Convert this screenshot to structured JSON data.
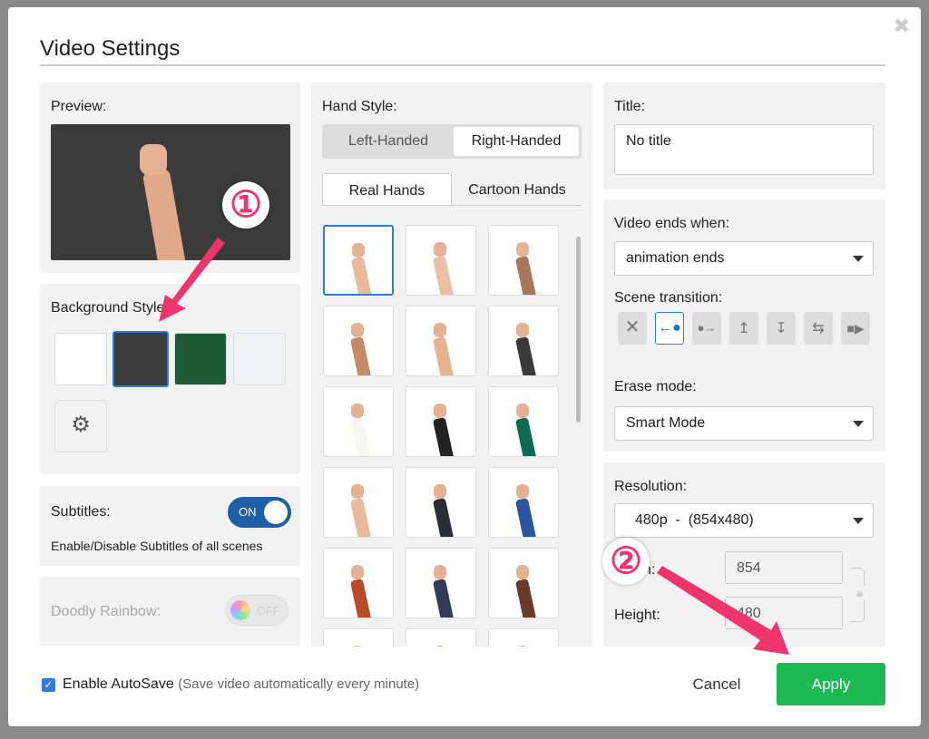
{
  "dialog": {
    "title": "Video Settings",
    "close_icon": "close-icon"
  },
  "preview": {
    "label": "Preview:"
  },
  "background": {
    "label": "Background Style:",
    "swatches": [
      "#ffffff",
      "#3b3b3b",
      "#1f5a36",
      "#f0f2f7"
    ],
    "selected": 1
  },
  "subtitles": {
    "label": "Subtitles:",
    "toggle": "ON",
    "description": "Enable/Disable Subtitles of all scenes"
  },
  "rainbow": {
    "label": "Doodly Rainbow:",
    "toggle": "OFF"
  },
  "hand_style": {
    "label": "Hand Style:",
    "options": [
      "Left-Handed",
      "Right-Handed"
    ],
    "selected": "Right-Handed",
    "tabs": [
      "Real Hands",
      "Cartoon Hands"
    ],
    "active_tab": "Real Hands",
    "hands": [
      "#e8b99a",
      "#e9c0a5",
      "#a8775a",
      "#c58a66",
      "#e5b48e",
      "#3a3a3a",
      "#f7f7f4",
      "#222222",
      "#0f6b4e",
      "#e8b99a",
      "#2a2d33",
      "#2a56a0",
      "#b8492a",
      "#333a55",
      "#6a3a28"
    ]
  },
  "title_field": {
    "label": "Title:",
    "value": "No title"
  },
  "video_ends": {
    "label": "Video ends when:",
    "value": "animation ends"
  },
  "scene_transition": {
    "label": "Scene transition:",
    "icons": [
      "none-icon",
      "slide-left-icon",
      "slide-right-icon",
      "slide-up-icon",
      "slide-down-icon",
      "swap-icon",
      "camera-icon"
    ],
    "selected": 1
  },
  "erase_mode": {
    "label": "Erase mode:",
    "value": "Smart Mode"
  },
  "resolution": {
    "label": "Resolution:",
    "value": "480p  -  (854x480)",
    "width_label": "Width:",
    "width": "854",
    "height_label": "Height:",
    "height": "480"
  },
  "footer": {
    "autosave_label": "Enable AutoSave",
    "autosave_hint": "(Save video automatically every minute)",
    "autosave_checked": true,
    "cancel": "Cancel",
    "apply": "Apply"
  },
  "annotations": {
    "one": "①",
    "two": "②"
  },
  "colors": {
    "accent": "#2f7be0",
    "apply": "#1db954",
    "annotation": "#f0356e"
  }
}
